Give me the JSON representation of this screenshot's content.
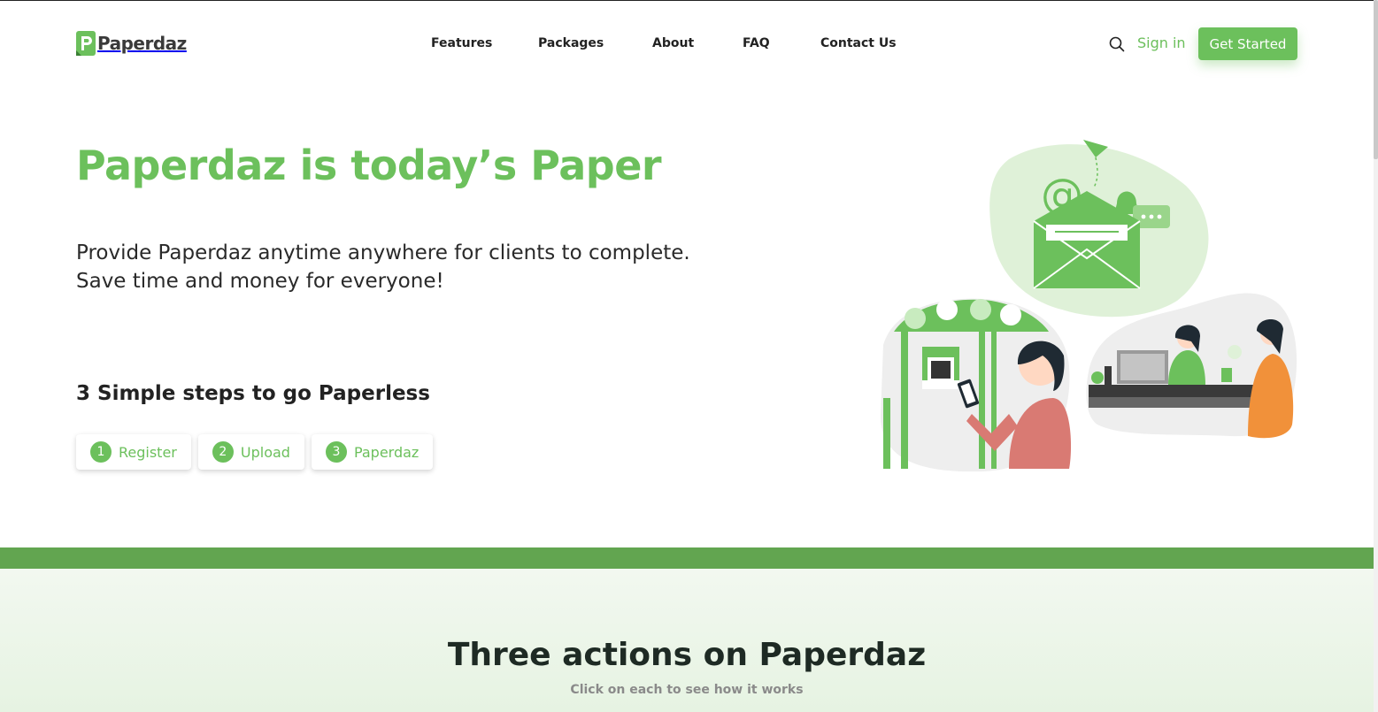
{
  "brand": {
    "name": "Paperdaz",
    "accent": "#6cc05c",
    "band": "#62a550"
  },
  "nav": {
    "items": [
      "Features",
      "Packages",
      "About",
      "FAQ",
      "Contact Us"
    ],
    "search_icon": "search-icon",
    "signin": "Sign in",
    "cta": "Get Started"
  },
  "hero": {
    "title": "Paperdaz is today’s Paper",
    "subtitle_line1": "Provide Paperdaz anytime anywhere for clients to complete.",
    "subtitle_line2": "Save time and money for everyone!",
    "steps_title": "3 Simple steps to go Paperless",
    "steps": [
      {
        "num": "1",
        "label": "Register"
      },
      {
        "num": "2",
        "label": "Upload"
      },
      {
        "num": "3",
        "label": "Paperdaz"
      }
    ]
  },
  "section2": {
    "title": "Three actions on Paperdaz",
    "subtitle": "Click on each to see how it works"
  }
}
